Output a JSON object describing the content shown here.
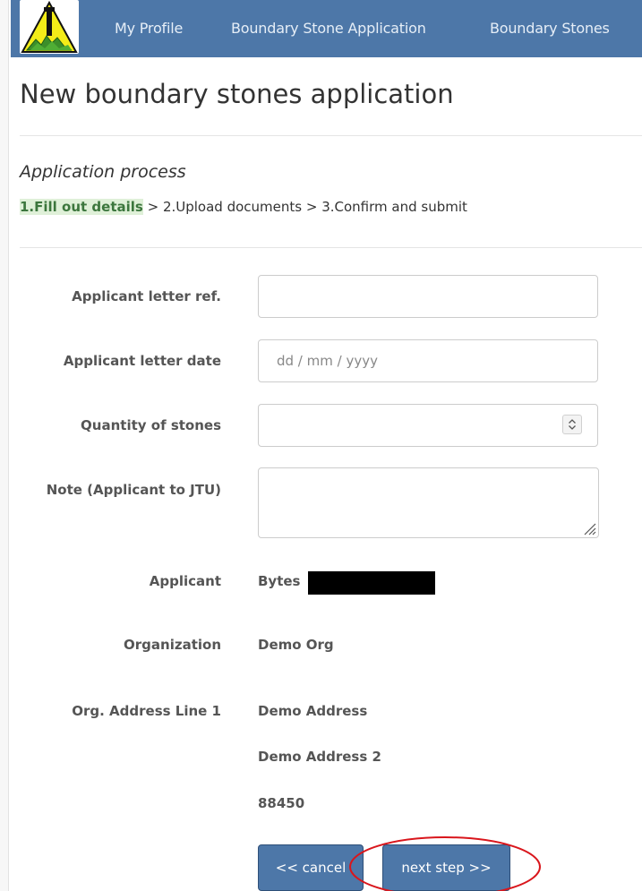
{
  "nav": {
    "logo_name": "organization-logo",
    "links": [
      "My Profile",
      "Boundary Stone Application",
      "Boundary Stones"
    ]
  },
  "page": {
    "title": "New boundary stones application"
  },
  "process": {
    "title": "Application process",
    "steps": [
      "1.Fill out details",
      "2.Upload documents",
      "3.Confirm and submit"
    ],
    "separator": " > ",
    "active_step": 0
  },
  "form": {
    "letter_ref": {
      "label": "Applicant letter ref.",
      "value": ""
    },
    "letter_date": {
      "label": "Applicant letter date",
      "placeholder": "dd / mm / yyyy"
    },
    "quantity": {
      "label": "Quantity of stones",
      "value": ""
    },
    "note": {
      "label": "Note (Applicant to JTU)",
      "value": ""
    }
  },
  "details": {
    "applicant": {
      "label": "Applicant",
      "value": "Bytes"
    },
    "organization": {
      "label": "Organization",
      "value": "Demo Org"
    },
    "address": {
      "label": "Org. Address Line 1",
      "line1": "Demo Address",
      "line2": "Demo Address 2",
      "line3": "88450"
    }
  },
  "buttons": {
    "cancel": "<< cancel",
    "next": "next step >>"
  },
  "colors": {
    "navbar": "#4d77a8",
    "active_step_bg": "#dff0d8",
    "active_step_text": "#3c763d",
    "annotation": "#d9161c"
  }
}
